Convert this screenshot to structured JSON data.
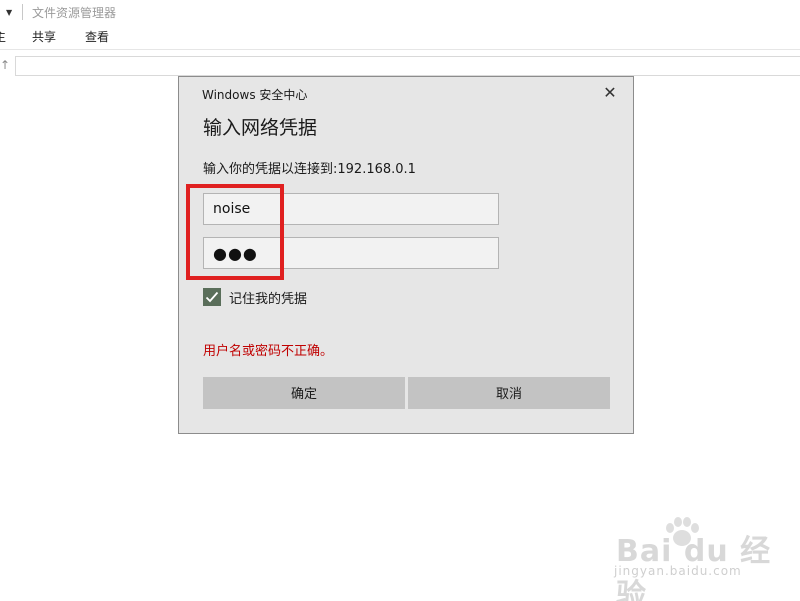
{
  "explorer": {
    "window_title": "文件资源管理器",
    "ribbon_tabs": [
      "主",
      "共享",
      "查看"
    ],
    "up_arrow": "↑"
  },
  "dialog": {
    "caption": "Windows 安全中心",
    "heading": "输入网络凭据",
    "prompt": "输入你的凭据以连接到:192.168.0.1",
    "username_value": "noise",
    "password_mask": "●●●",
    "remember_label": "记住我的凭据",
    "remember_checked": true,
    "error_text": "用户名或密码不正确。",
    "ok_label": "确定",
    "cancel_label": "取消",
    "close_glyph": "✕"
  },
  "watermark": {
    "logo_text": "Bai du 经验",
    "site_text": "jingyan.baidu.com"
  },
  "colors": {
    "dialog_bg": "#e6e6e6",
    "button_bg": "#c3c3c3",
    "error": "#c00000",
    "highlight": "#e02020",
    "checkbox": "#5a6e5a"
  },
  "icons": {
    "close": "close-icon",
    "check": "checkmark-icon",
    "up": "arrow-up-icon",
    "dropdown": "chevron-down-icon"
  }
}
